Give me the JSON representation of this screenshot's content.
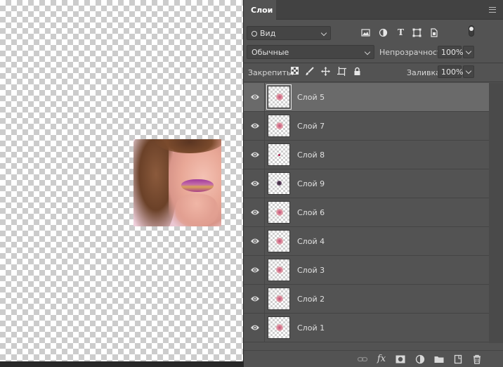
{
  "panel": {
    "tab_label": "Слои",
    "filter": {
      "selected": "Вид"
    },
    "blend_mode": {
      "selected": "Обычные"
    },
    "opacity": {
      "label": "Непрозрачность:",
      "value": "100%"
    },
    "lock": {
      "label": "Закрепить:"
    },
    "fill": {
      "label": "Заливка:",
      "value": "100%"
    }
  },
  "layers": [
    {
      "name": "Слой 5",
      "selected": true
    },
    {
      "name": "Слой 7",
      "selected": false
    },
    {
      "name": "Слой 8",
      "selected": false
    },
    {
      "name": "Слой 9",
      "selected": false
    },
    {
      "name": "Слой 6",
      "selected": false
    },
    {
      "name": "Слой 4",
      "selected": false
    },
    {
      "name": "Слой 3",
      "selected": false
    },
    {
      "name": "Слой 2",
      "selected": false
    },
    {
      "name": "Слой 1",
      "selected": false
    }
  ],
  "icons": {
    "filter_kinds": [
      "image-filter-icon",
      "adjustment-filter-icon",
      "type-filter-icon",
      "shape-filter-icon",
      "smart-object-filter-icon",
      "filter-toggle-icon"
    ],
    "locks": [
      "lock-transparent-pixels-icon",
      "lock-image-pixels-icon",
      "lock-position-icon",
      "lock-artboard-icon",
      "lock-all-icon"
    ],
    "bottom": [
      "link-layers-icon",
      "fx-icon",
      "add-mask-icon",
      "new-adjustment-icon",
      "new-group-icon",
      "new-layer-icon",
      "delete-layer-icon"
    ]
  },
  "colors": {
    "panel": "#535353",
    "selected_layer": "#6a6a6a",
    "tabbar": "#424242"
  }
}
